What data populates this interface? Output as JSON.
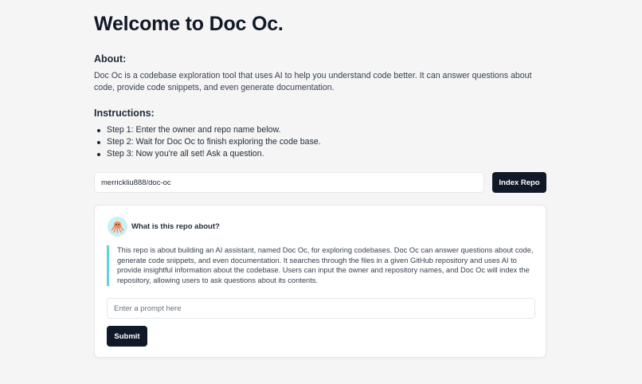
{
  "page_title": "Welcome to Doc Oc.",
  "about": {
    "heading": "About:",
    "text": "Doc Oc is a codebase exploration tool that uses AI to help you understand code better. It can answer questions about code, provide code snippets, and even generate documentation."
  },
  "instructions": {
    "heading": "Instructions:",
    "steps": [
      "Step 1: Enter the owner and repo name below.",
      "Step 2: Wait for Doc Oc to finish exploring the code base.",
      "Step 3: Now you're all set! Ask a question."
    ]
  },
  "repo": {
    "value": "merrickliu888/doc-oc",
    "button_label": "Index Repo"
  },
  "chat": {
    "avatar_icon": "octopus-icon",
    "question": "What is this repo about?",
    "answer": "This repo is about building an AI assistant, named Doc Oc, for exploring codebases. Doc Oc can answer questions about code, generate code snippets, and even documentation. It searches through the files in a given GitHub repository and uses AI to provide insightful information about the codebase. Users can input the owner and repository names, and Doc Oc will index the repository, allowing users to ask questions about its contents.",
    "prompt_placeholder": "Enter a prompt here",
    "submit_label": "Submit"
  },
  "colors": {
    "background": "#f5f5f5",
    "button": "#111827",
    "accent_border": "#5fd3db",
    "avatar_bg": "#cdeef3",
    "octopus": "#f08a5d"
  }
}
